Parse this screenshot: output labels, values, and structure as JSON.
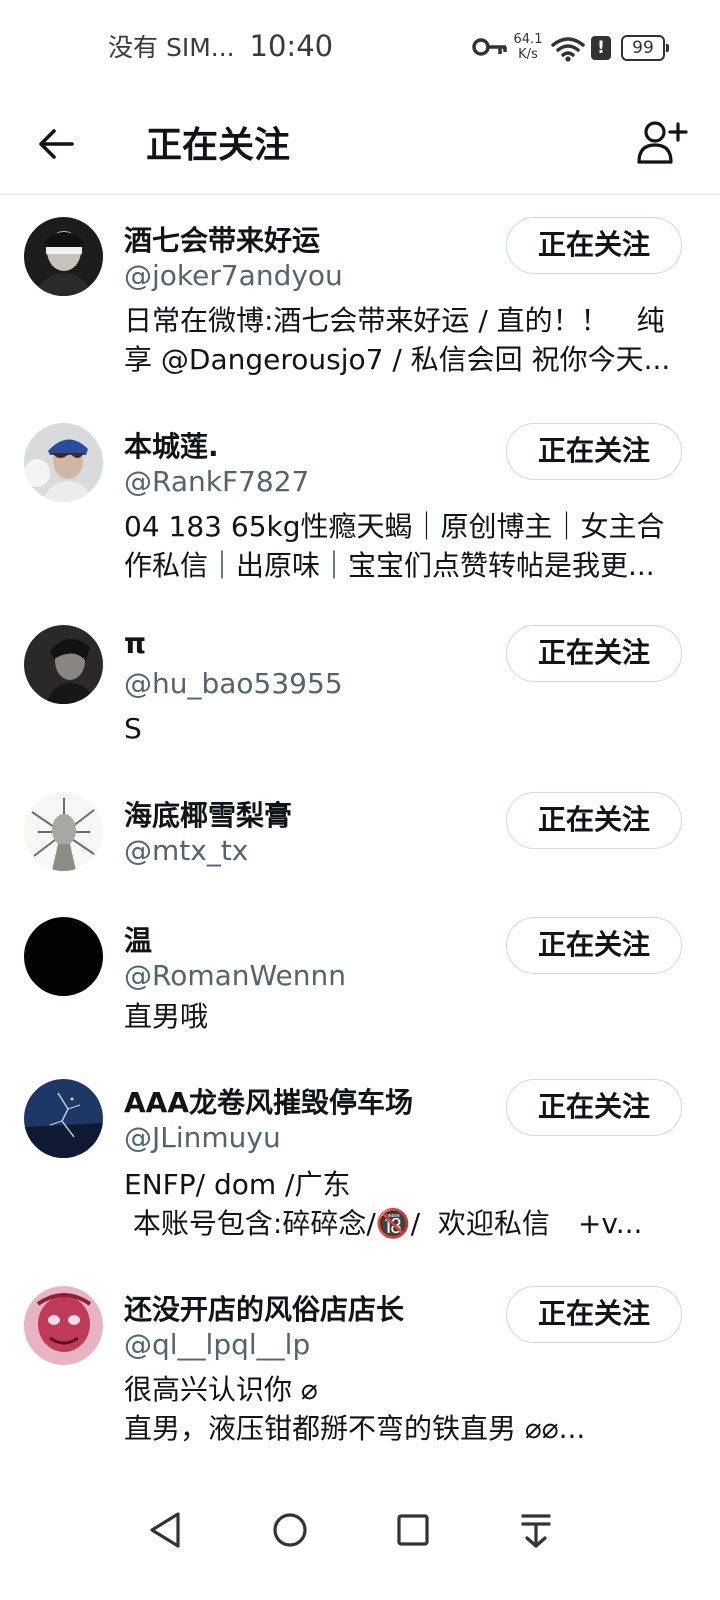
{
  "status_bar": {
    "carrier": "没有 SIM...",
    "time": "10:40",
    "net_speed_value": "64.1",
    "net_speed_unit": "K/s",
    "alert": "!",
    "battery": "99",
    "icons": [
      "key-icon",
      "wifi-icon",
      "alert-icon",
      "battery-icon"
    ]
  },
  "header": {
    "title": "正在关注",
    "back_icon": "arrow-left-icon",
    "add_icon": "add-user-icon"
  },
  "users": [
    {
      "name": "酒七会带来好运",
      "handle": "@joker7andyou",
      "bio": "日常在微博:酒七会带来好运 / 直的！！　纯享 @Dangerousjo7 / 私信会回 祝你今天...",
      "button": "正在关注"
    },
    {
      "name": "本城莲.",
      "handle": "@RankF7827",
      "bio": "04 183 65kg性瘾天蝎｜原创博主｜女主合作私信｜出原味｜宝宝们点赞转帖是我更...",
      "button": "正在关注"
    },
    {
      "name": "π",
      "handle": "@hu_bao53955",
      "bio": "S",
      "button": "正在关注"
    },
    {
      "name": "海底椰雪梨膏",
      "handle": "@mtx_tx",
      "bio": "",
      "button": "正在关注"
    },
    {
      "name": "温",
      "handle": "@RomanWennn",
      "bio": "直男哦",
      "button": "正在关注"
    },
    {
      "name": "AAA龙卷风摧毁停车场",
      "handle": "@JLinmuyu",
      "bio": "ENFP/ dom /广东\n 本账号包含:碎碎念/🔞/  欢迎私信　+v...",
      "button": "正在关注"
    },
    {
      "name": "还没开店的风俗店店长",
      "handle": "@ql__lpql__lp",
      "bio": "很高兴认识你 ⌀\n直男，液压钳都掰不弯的铁直男 ⌀⌀...",
      "button": "正在关注"
    }
  ],
  "nav_bar": {
    "icons": [
      "back-triangle-icon",
      "home-circle-icon",
      "recents-square-icon",
      "notification-pull-icon"
    ]
  }
}
